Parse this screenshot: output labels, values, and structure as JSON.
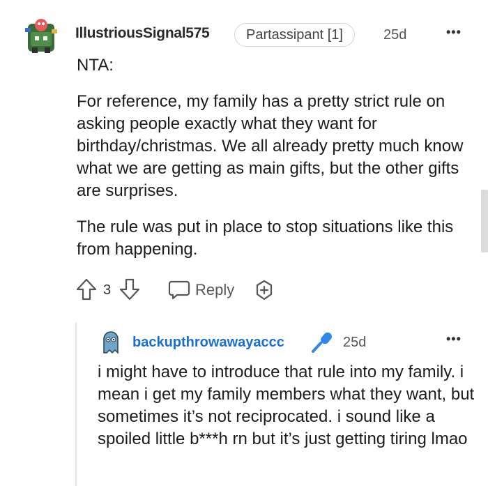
{
  "comment": {
    "username": "IllustriousSignal575",
    "flair": "Partassipant [1]",
    "age": "25d",
    "more": "•••",
    "paragraphs": [
      "NTA:",
      "For reference, my family has a pretty strict rule on asking people exactly what they want for birthday/christmas. We all already pretty much know what we are getting as main gifts, but the other gifts are surprises.",
      "The rule was put in place to stop situations like this from happening."
    ],
    "score": "3",
    "reply_label": "Reply"
  },
  "reply": {
    "username": "backupthrowawayaccc",
    "age": "25d",
    "more": "•••",
    "text": "i might have to introduce that rule into my family. i mean i get my family members what they want, but sometimes it’s not reciprocated. i sound like a spoiled little b***h rn but it’s just getting tiring lmao"
  },
  "colors": {
    "username_reply": "#1a6fd1",
    "mic_icon": "#2d89e5",
    "text": "#1c1c1c"
  },
  "icons": [
    "avatar",
    "upvote-icon",
    "downvote-icon",
    "reply-bubble-icon",
    "award-icon",
    "microphone-icon",
    "more-icon"
  ]
}
